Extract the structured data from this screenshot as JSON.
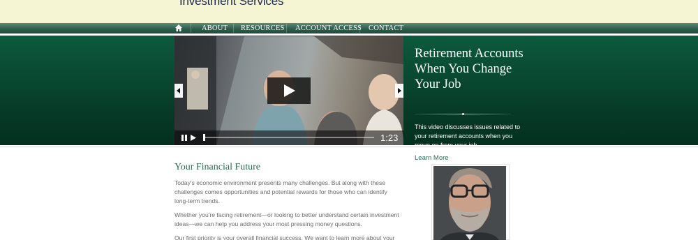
{
  "header": {
    "brand": "Investment Services"
  },
  "nav": {
    "home_icon": "home-icon",
    "items": [
      {
        "label": "ABOUT"
      },
      {
        "label": "RESOURCES"
      },
      {
        "label": "ACCOUNT ACCESS"
      },
      {
        "label": "CONTACT"
      }
    ]
  },
  "hero": {
    "title": "Retirement Accounts When You Change Your Job",
    "description": "This video discusses issues related to your retirement accounts when you move on from your job."
  },
  "video": {
    "time": "1:23",
    "progress": 0.0,
    "controls": [
      "pause-icon",
      "play-icon",
      "play-large-icon",
      "prev-arrow-icon",
      "next-arrow-icon"
    ]
  },
  "sidebar": {
    "learn_more": "Learn More",
    "photo": "advisor-portrait"
  },
  "main": {
    "section_title": "Your Financial Future",
    "paragraphs": [
      "Today's economic environment presents many challenges. But along with these challenges comes opportunities and potential rewards for those who can identify long-term trends.",
      "Whether you're facing retirement—or looking to better understand certain investment ideas—we can help you address your most pressing money questions.",
      "Our first priority is your overall financial success. We want to learn more about your"
    ]
  },
  "colors": {
    "accent_green": "#2d6b52",
    "hero_green": "#0d5a3d",
    "top_band": "#f5f5d3"
  }
}
